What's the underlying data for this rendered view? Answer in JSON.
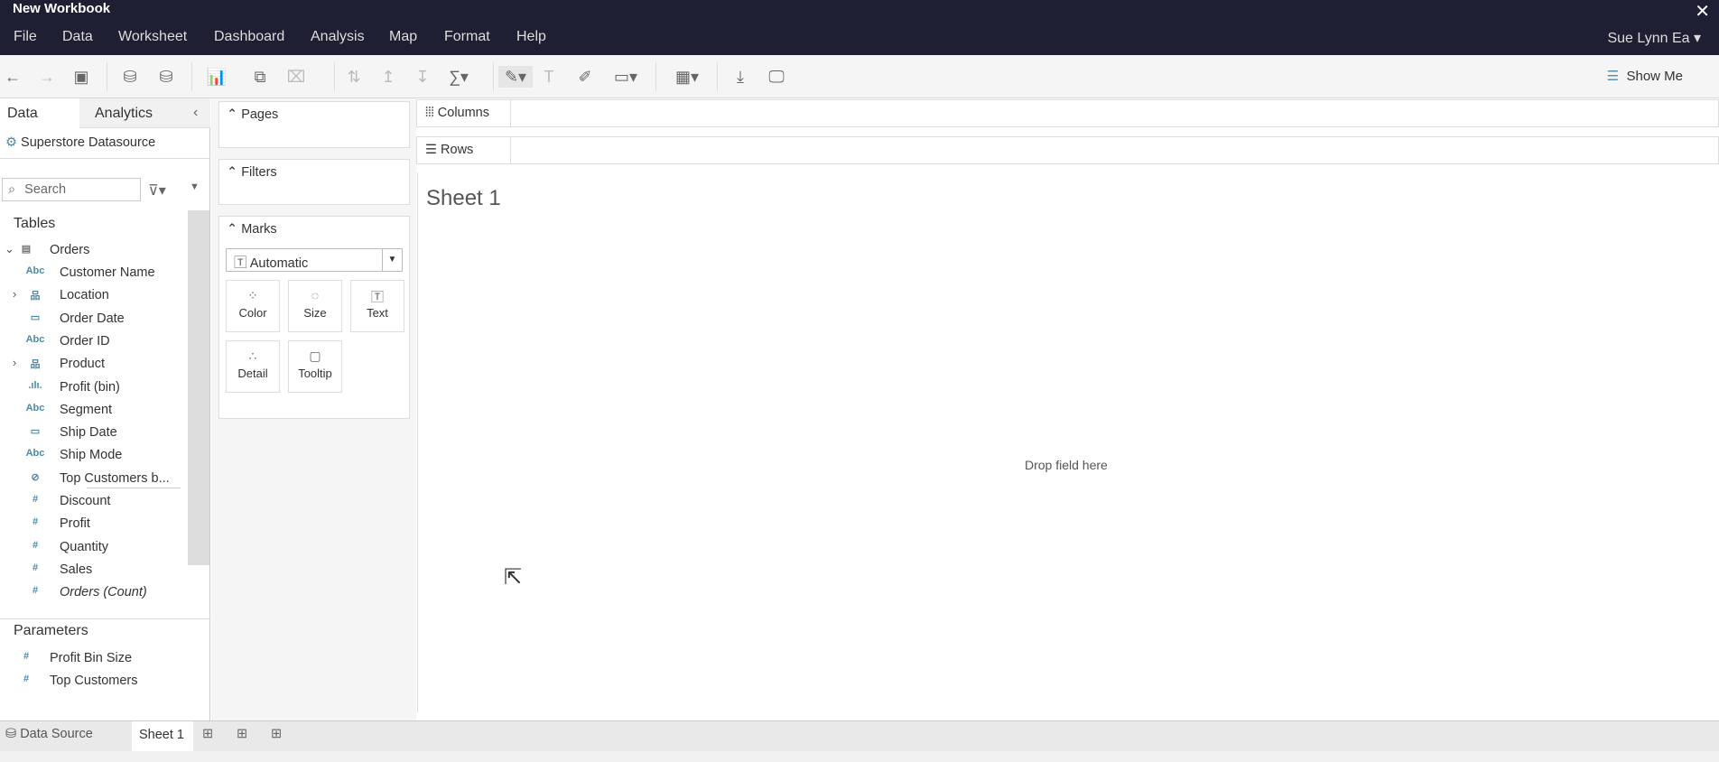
{
  "window": {
    "title": "New Workbook",
    "close_icon": "close-icon"
  },
  "menu": [
    "File",
    "Data",
    "Worksheet",
    "Dashboard",
    "Analysis",
    "Map",
    "Format",
    "Help"
  ],
  "user": "Sue Lynn Ea",
  "toolbar": {
    "show_me": "Show Me"
  },
  "left": {
    "tabs": [
      "Data",
      "Analytics"
    ],
    "datasource": "Superstore Datasource",
    "search_placeholder": "Search",
    "tables_heading": "Tables",
    "table": "Orders",
    "fields": [
      {
        "type": "Abc",
        "name": "Customer Name"
      },
      {
        "type": "hier",
        "name": "Location",
        "expand": true
      },
      {
        "type": "date",
        "name": "Order Date"
      },
      {
        "type": "Abc",
        "name": "Order ID"
      },
      {
        "type": "hier",
        "name": "Product",
        "expand": true
      },
      {
        "type": "bin",
        "name": "Profit (bin)"
      },
      {
        "type": "Abc",
        "name": "Segment"
      },
      {
        "type": "date",
        "name": "Ship Date"
      },
      {
        "type": "Abc",
        "name": "Ship Mode"
      },
      {
        "type": "set",
        "name": "Top Customers b..."
      },
      {
        "type": "num",
        "name": "Discount"
      },
      {
        "type": "num",
        "name": "Profit"
      },
      {
        "type": "num",
        "name": "Quantity"
      },
      {
        "type": "num",
        "name": "Sales"
      },
      {
        "type": "num",
        "name": "Orders (Count)",
        "italic": true
      }
    ],
    "parameters_heading": "Parameters",
    "parameters": [
      "Profit Bin Size",
      "Top Customers"
    ]
  },
  "cards": {
    "pages": "Pages",
    "filters": "Filters",
    "marks": "Marks",
    "mark_type": "Automatic",
    "buttons": [
      "Color",
      "Size",
      "Text",
      "Detail",
      "Tooltip"
    ]
  },
  "shelves": {
    "columns": "Columns",
    "rows": "Rows"
  },
  "sheet": {
    "title": "Sheet 1",
    "drop_hint": "Drop field here"
  },
  "tabs": {
    "data_source": "Data Source",
    "sheet": "Sheet 1"
  }
}
